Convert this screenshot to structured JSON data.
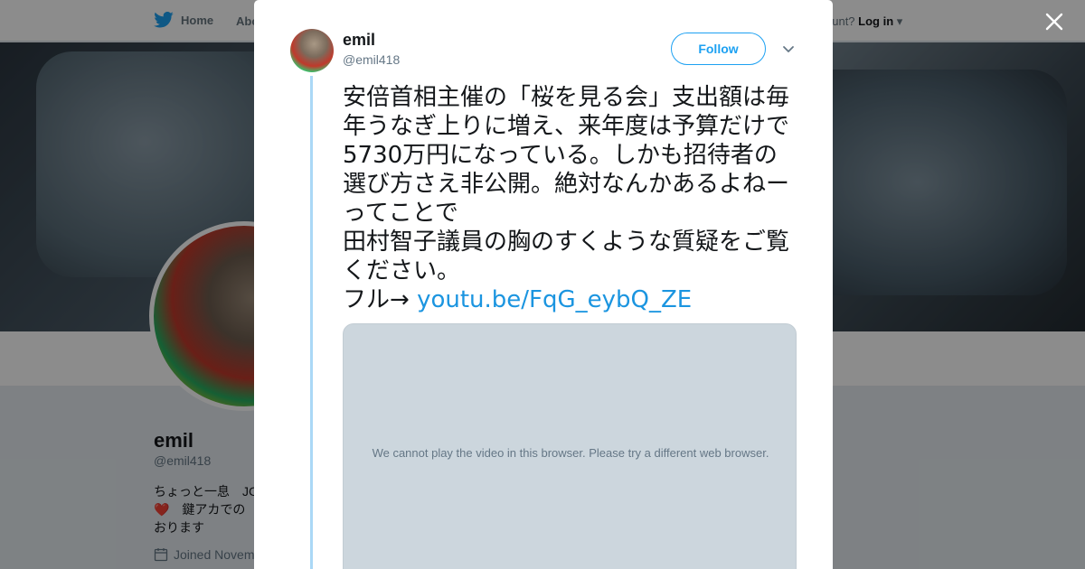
{
  "nav": {
    "home_label": "Home",
    "about_label": "Abo",
    "account_prompt": "ccount?",
    "login_label": "Log in"
  },
  "profile": {
    "name": "emil",
    "handle": "@emil418",
    "bio": "ちょっと一息　JC❤️　鍵アカでの\nおります",
    "joined": "Joined Novem"
  },
  "tweet": {
    "author_name": "emil",
    "author_handle": "@emil418",
    "follow_label": "Follow",
    "text_line_1": "安倍首相主催の「桜を見る会」支出額は毎年うなぎ上りに増え、来年度は予算だけで5730万円になっている。しかも招待者の選び方さえ非公開。絶対なんかあるよねーってことで",
    "text_line_2": "田村智子議員の胸のすくような質疑をご覧ください。",
    "text_prefix": "フル→ ",
    "link_text": "youtu.be/FqG_eybQ_ZE",
    "video_message": "We cannot play the video in this browser. Please try a different web browser."
  },
  "icons": {
    "twitter_bird": "twitter-bird-icon",
    "close": "close-icon",
    "caret": "chevron-down-icon",
    "calendar": "calendar-icon"
  },
  "colors": {
    "twitter_blue": "#1da1f2",
    "link_blue": "#1b95e0",
    "thread_line": "#aad8f6",
    "video_bg": "#ccd6dd"
  }
}
